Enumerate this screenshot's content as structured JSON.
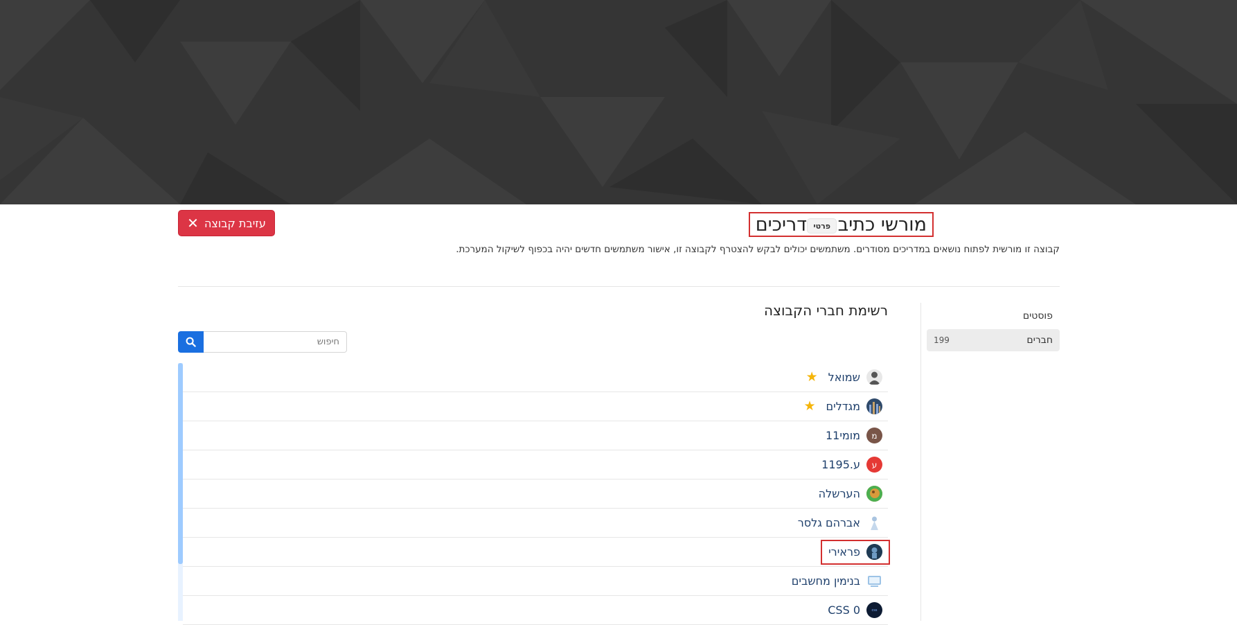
{
  "header": {
    "group_title": "מורשי כתיבת מדריכים",
    "privacy_badge": "פרטי",
    "description": "קבוצה זו מורשית לפתוח נושאים במדריכים מסודרים. משתמשים יכולים לבקש להצטרף לקבוצה זו, אישור משתמשים חדשים יהיה בכפוף לשיקול המערכת.",
    "leave_button": "עזיבת קבוצה",
    "leave_icon": "close-icon"
  },
  "sidebar": {
    "items": [
      {
        "label": "פוסטים",
        "count": ""
      },
      {
        "label": "חברים",
        "count": "199"
      }
    ]
  },
  "members": {
    "title": "רשימת חברי הקבוצה",
    "search_placeholder": "חיפוש",
    "search_icon": "search-icon",
    "list": [
      {
        "name": "שמואל",
        "avatar_letter": "",
        "avatar_color": "#6d6d6d",
        "star": true
      },
      {
        "name": "מגדלים",
        "avatar_letter": "",
        "avatar_color": "#2f4a6b",
        "star": true
      },
      {
        "name": "מומי11",
        "avatar_letter": "מ",
        "avatar_color": "#795548",
        "star": false
      },
      {
        "name": "ע.1195",
        "avatar_letter": "ע",
        "avatar_color": "#e53935",
        "star": false
      },
      {
        "name": "הערשלה",
        "avatar_letter": "",
        "avatar_color": "#c98a2e",
        "star": false
      },
      {
        "name": "אברהם גלסר",
        "avatar_letter": "",
        "avatar_color": "#dfe7f0",
        "star": false
      },
      {
        "name": "פראירי",
        "avatar_letter": "",
        "avatar_color": "#1f3b54",
        "star": false
      },
      {
        "name": "בנימין מחשבים",
        "avatar_letter": "",
        "avatar_color": "#9cc3e6",
        "star": false
      },
      {
        "name": "CSS 0",
        "avatar_letter": "",
        "avatar_color": "#0d1b33",
        "star": false
      }
    ]
  },
  "colors": {
    "cover": "#353535",
    "danger": "#dc3545",
    "primary": "#1a6fe0",
    "star": "#f5b50a",
    "highlight": "#d32f2f"
  }
}
